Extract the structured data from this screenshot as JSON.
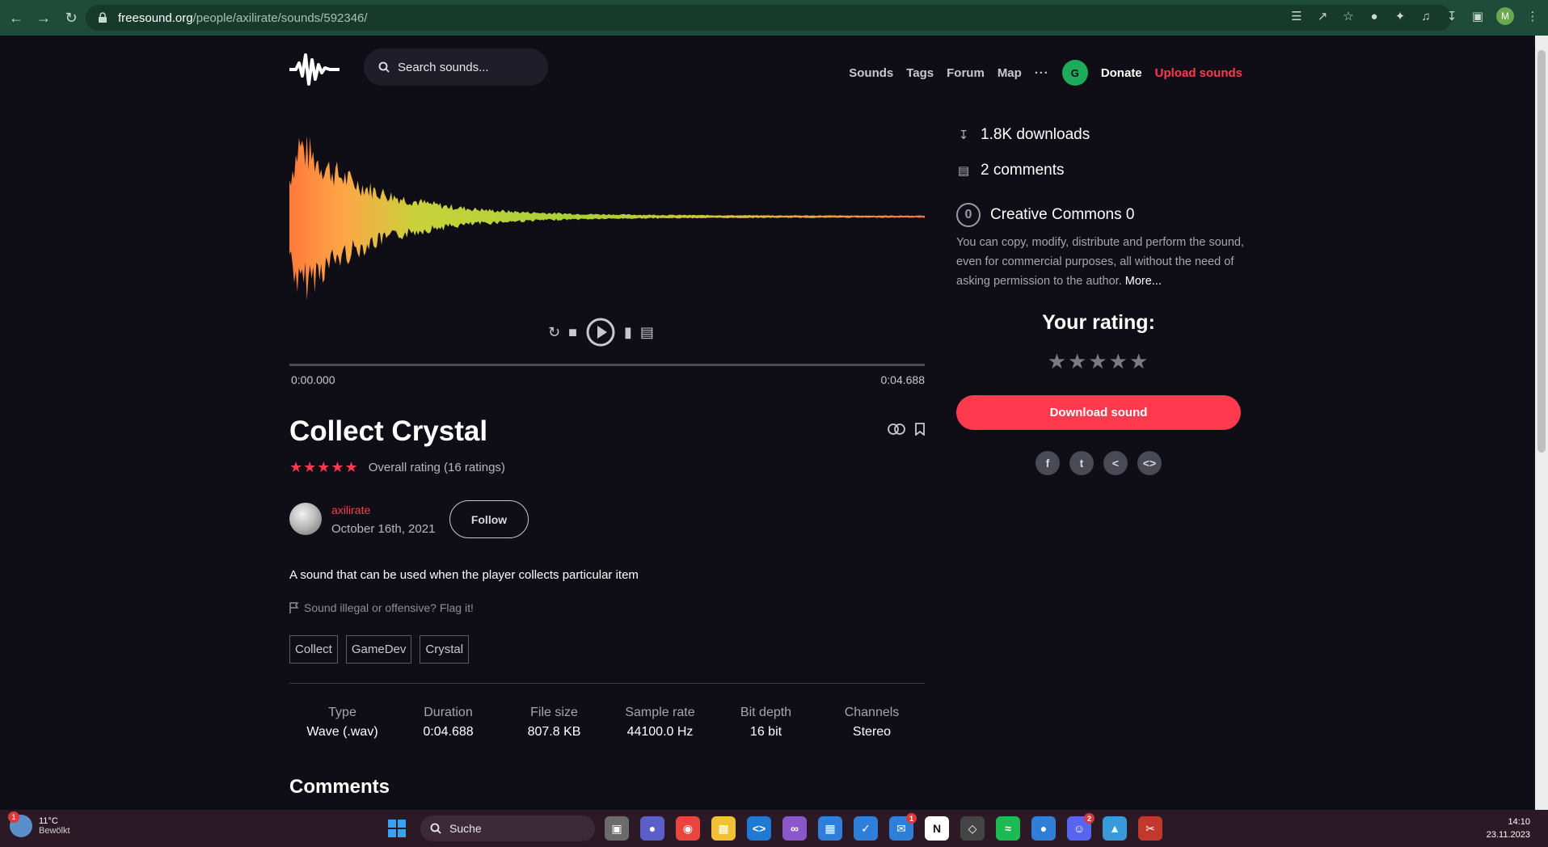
{
  "browser": {
    "url_host": "freesound.org",
    "url_path": "/people/axilirate/sounds/592346/",
    "profile_initial": "M"
  },
  "header": {
    "search_placeholder": "Search sounds...",
    "nav": [
      "Sounds",
      "Tags",
      "Forum",
      "Map"
    ],
    "more": "···",
    "user_initial": "G",
    "donate": "Donate",
    "upload": "Upload sounds"
  },
  "player": {
    "time_start": "0:00.000",
    "time_end": "0:04.688",
    "progress": 0
  },
  "sound": {
    "title": "Collect Crystal",
    "stars": "★★★★★",
    "rating_text": "Overall rating (16 ratings)",
    "username": "axilirate",
    "date": "October 16th, 2021",
    "follow": "Follow",
    "description": "A sound that can be used when the player collects particular item",
    "flag": "Sound illegal or offensive? Flag it!",
    "tags": [
      "Collect",
      "GameDev",
      "Crystal"
    ]
  },
  "specs": [
    {
      "key": "Type",
      "value": "Wave (.wav)"
    },
    {
      "key": "Duration",
      "value": "0:04.688"
    },
    {
      "key": "File size",
      "value": "807.8 KB"
    },
    {
      "key": "Sample rate",
      "value": "44100.0 Hz"
    },
    {
      "key": "Bit depth",
      "value": "16 bit"
    },
    {
      "key": "Channels",
      "value": "Stereo"
    }
  ],
  "comments_title": "Comments",
  "sidebar": {
    "downloads": "1.8K downloads",
    "comments": "2 comments",
    "license_title": "Creative Commons 0",
    "license_desc": "You can copy, modify, distribute and perform the sound, even for commercial purposes, all without the need of asking permission to the author.",
    "license_more": "More...",
    "your_rating": "Your rating:",
    "rating_stars": "★★★★★",
    "download_button": "Download sound"
  },
  "taskbar": {
    "weather_temp": "11°C",
    "weather_desc": "Bewölkt",
    "weather_badge": "1",
    "search": "Suche",
    "time": "14:10",
    "date": "23.11.2023",
    "mail_badge": "1",
    "discord_badge": "2"
  },
  "colors": {
    "accent": "#ff3a4f",
    "background": "#0f0e17",
    "browser_bar": "#1f4b3a"
  }
}
